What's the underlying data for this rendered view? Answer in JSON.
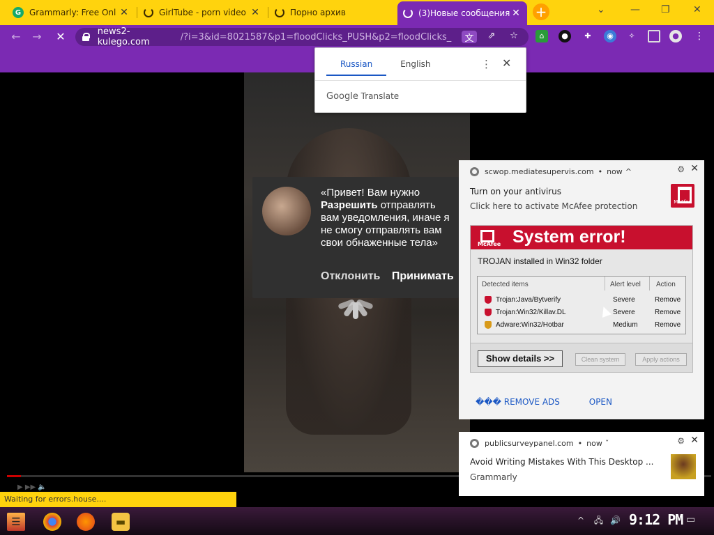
{
  "browser": {
    "tabs": [
      {
        "title": "Grammarly: Free Onl",
        "icon": "grammarly-icon"
      },
      {
        "title": "GirlTube - porn video",
        "icon": "loading-icon"
      },
      {
        "title": "Порно архив",
        "icon": "loading-icon"
      },
      {
        "title": "(3)Новые сообщения",
        "icon": "loading-icon",
        "active": true
      }
    ],
    "new_tab": "+",
    "url_host": "news2-kulego.com",
    "url_rest": "/?i=3&id=8021587&p1=floodClicks_PUSH&p2=floodClicks_",
    "theme_color": "#7b2ab3",
    "tabbar_color": "#ffd30d"
  },
  "translate_popup": {
    "lang_source": "Russian",
    "lang_target": "English",
    "brand": "Google",
    "brand_suffix": "Translate"
  },
  "permission_prompt": {
    "text_before": "«Привет! Вам нужно ",
    "text_bold": "Разрешить",
    "text_after": " отправлять вам уведомления, иначе я не смогу отправлять вам свои обнаженные тела»",
    "decline": "Отклонить",
    "accept": "Принимать"
  },
  "notification_1": {
    "source": "scwop.mediatesupervis.com",
    "time": "now",
    "title": "Turn on your antivirus",
    "body": "Click here to activate McAfee protection",
    "logo_text": "McAfee",
    "image": {
      "brand": "McAfee",
      "headline": "System error!",
      "subtitle": "TROJAN installed in Win32 folder",
      "columns": [
        "Detected items",
        "Alert level",
        "Action"
      ],
      "rows": [
        {
          "item": "Trojan:Java/Bytverify",
          "level": "Severe",
          "action": "Remove"
        },
        {
          "item": "Trojan:Win32/Killav.DL",
          "level": "Severe",
          "action": "Remove"
        },
        {
          "item": "Adware:Win32/Hotbar",
          "level": "Medium",
          "action": "Remove"
        }
      ],
      "show_details": "Show details >>",
      "clean_system": "Clean system",
      "apply_actions": "Apply actions"
    },
    "action_remove": "��� REMOVE ADS",
    "action_open": "OPEN"
  },
  "notification_2": {
    "source": "publicsurveypanel.com",
    "time": "now",
    "title": "Avoid Writing Mistakes With This Desktop ...",
    "body": "Grammarly"
  },
  "status_bar": "Waiting for errors.house....",
  "taskbar": {
    "clock": "9:12 PM"
  }
}
